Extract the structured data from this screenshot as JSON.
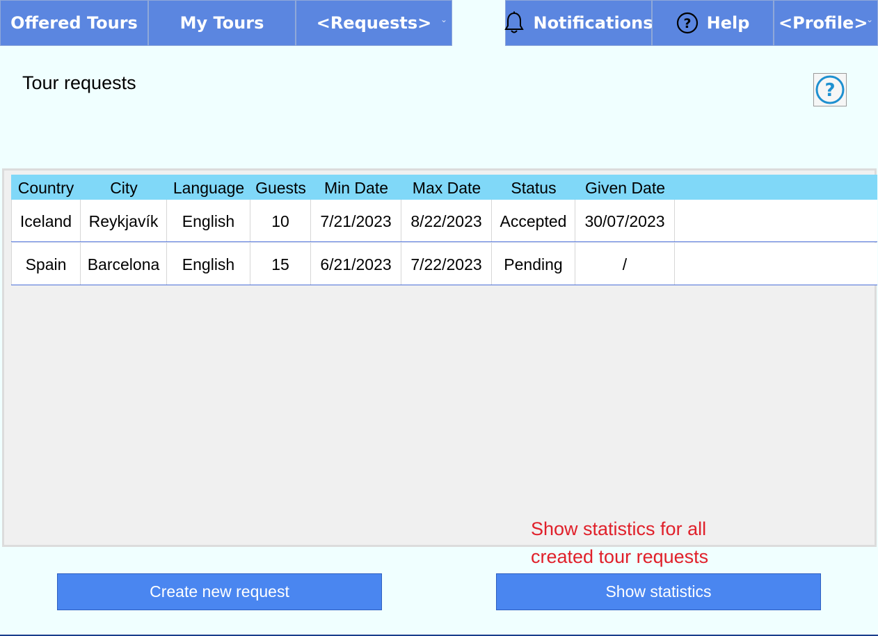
{
  "nav": {
    "offered_tours": "Offered Tours",
    "my_tours": "My Tours",
    "requests": "<Requests>",
    "notifications": "Notifications",
    "help": "Help",
    "profile": "<Profile>"
  },
  "page": {
    "title": "Tour requests"
  },
  "table": {
    "headers": [
      "Country",
      "City",
      "Language",
      "Guests",
      "Min Date",
      "Max Date",
      "Status",
      "Given Date"
    ],
    "rows": [
      [
        "Iceland",
        "Reykjavík",
        "English",
        "10",
        "7/21/2023",
        "8/22/2023",
        "Accepted",
        "30/07/2023"
      ],
      [
        "Spain",
        "Barcelona",
        "English",
        "15",
        "6/21/2023",
        "7/22/2023",
        "Pending",
        "/"
      ]
    ]
  },
  "note": {
    "line1": "Show statistics for all",
    "line2": "created tour requests"
  },
  "buttons": {
    "create": "Create new request",
    "statistics": "Show statistics"
  },
  "colors": {
    "nav_bg": "#5b86e0",
    "table_header": "#80d8f8",
    "button_bg": "#4a86f0",
    "note_text": "#e0202a",
    "page_bg": "#f0ffff"
  },
  "icons": {
    "notifications": "bell-icon",
    "help": "question-circle-icon",
    "page_help": "question-circle-icon"
  }
}
